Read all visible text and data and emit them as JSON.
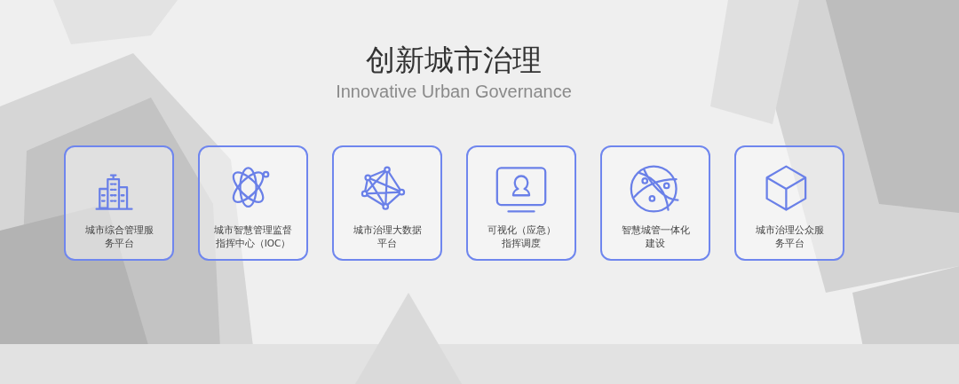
{
  "header": {
    "title": "创新城市治理",
    "subtitle": "Innovative Urban Governance"
  },
  "cards": [
    {
      "kind": "building",
      "label_lines": [
        "城市综合管理服",
        "务平台"
      ]
    },
    {
      "kind": "atom",
      "label_lines": [
        "城市智慧管理监督",
        "指挥中心（IOC）"
      ]
    },
    {
      "kind": "network",
      "label_lines": [
        "城市治理大数据",
        "平台"
      ]
    },
    {
      "kind": "monitor",
      "label_lines": [
        "可视化（应急）",
        "指挥调度"
      ]
    },
    {
      "kind": "globe",
      "label_lines": [
        "智慧城管一体化",
        "建设"
      ]
    },
    {
      "kind": "cube",
      "label_lines": [
        "城市治理公众服",
        "务平台"
      ]
    }
  ]
}
